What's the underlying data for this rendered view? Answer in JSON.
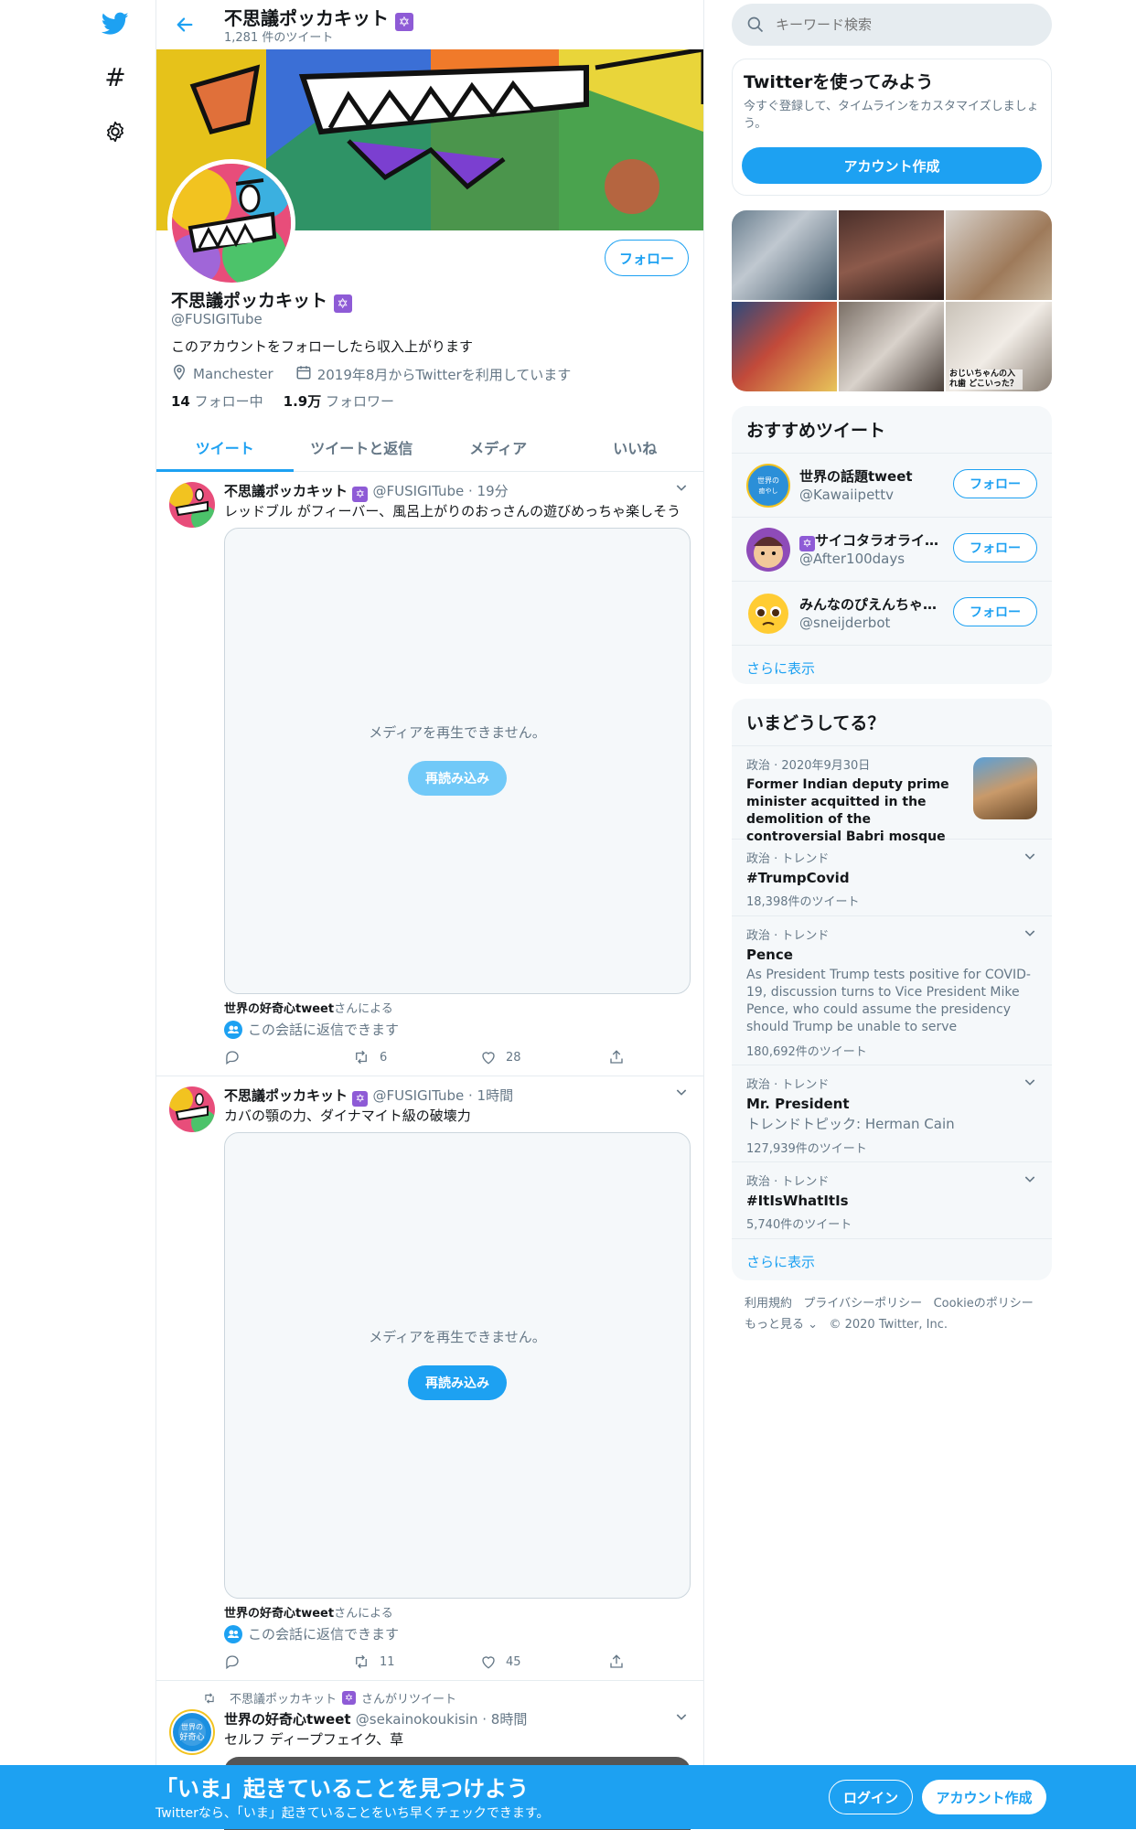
{
  "nav": {
    "brand_color": "#1da1f2"
  },
  "header": {
    "title": "不思議ポッカキット",
    "tweet_count": "1,281 件のツイート"
  },
  "profile": {
    "name": "不思議ポッカキット",
    "handle": "@FUSIGITube",
    "follow_label": "フォロー",
    "bio": "このアカウントをフォローしたら収入上がります",
    "location": "Manchester",
    "joined": "2019年8月からTwitterを利用しています",
    "following_count": "14",
    "following_label": "フォロー中",
    "followers_count": "1.9万",
    "followers_label": "フォロワー"
  },
  "tabs": [
    {
      "label": "ツイート"
    },
    {
      "label": "ツイートと返信"
    },
    {
      "label": "メディア"
    },
    {
      "label": "いいね"
    }
  ],
  "tweets": [
    {
      "name": "不思議ポッカキット",
      "meta": "@FUSIGITube · 19分",
      "text": "レッドブル がフィーバー、風呂上がりのおっさんの遊びめっちゃ楽しそう",
      "media_msg": "メディアを再生できません。",
      "reload": "再読み込み",
      "by_name": "世界の好奇心tweet",
      "by_suffix": "さんによる",
      "convo": "この会話に返信できます",
      "retweets": "6",
      "likes": "28"
    },
    {
      "name": "不思議ポッカキット",
      "meta": "@FUSIGITube · 1時間",
      "text": "カバの顎の力、ダイナマイト級の破壊力",
      "media_msg": "メディアを再生できません。",
      "reload": "再読み込み",
      "by_name": "世界の好奇心tweet",
      "by_suffix": "さんによる",
      "convo": "この会話に返信できます",
      "retweets": "11",
      "likes": "45"
    },
    {
      "retweeted_by": "不思議ポッカキット",
      "retweeted_suffix": "さんがリツイート",
      "name": "世界の好奇心tweet",
      "meta": "@sekainokoukisin · 8時間",
      "text": "セルフ ディープフェイク、草"
    }
  ],
  "search": {
    "placeholder": "キーワード検索"
  },
  "signup_card": {
    "title": "Twitterを使ってみよう",
    "desc": "今すぐ登録して、タイムラインをカスタマイズしましょう。",
    "button": "アカウント作成"
  },
  "photo_caption": "おじいちゃんの入れ歯 どこいった？",
  "recommended": {
    "title": "おすすめツイート",
    "users": [
      {
        "name": "世界の話題tweet",
        "handle": "@Kawaiipettv",
        "follow": "フォロー"
      },
      {
        "name": "サイコタラオライ…",
        "handle": "@After100days",
        "follow": "フォロー"
      },
      {
        "name": "みんなのぴえんちゃ…",
        "handle": "@sneijderbot",
        "follow": "フォロー"
      }
    ],
    "more": "さらに表示"
  },
  "trends": {
    "title": "いまどうしてる？",
    "items": [
      {
        "category": "政治 · 2020年9月30日",
        "title": "Former Indian deputy prime minister acquitted in the demolition of the controversial Babri mosque"
      },
      {
        "category": "政治 · トレンド",
        "title": "#TrumpCovid",
        "count": "18,398件のツイート"
      },
      {
        "category": "政治 · トレンド",
        "title": "Pence",
        "desc": "As President Trump tests positive for COVID-19, discussion turns to Vice President Mike Pence, who could assume the presidency should Trump be unable to serve",
        "count": "180,692件のツイート"
      },
      {
        "category": "政治 · トレンド",
        "title": "Mr. President",
        "desc": "トレンドトピック: Herman Cain",
        "count": "127,939件のツイート"
      },
      {
        "category": "政治 · トレンド",
        "title": "#ItIsWhatItIs",
        "count": "5,740件のツイート"
      }
    ],
    "more": "さらに表示"
  },
  "footer": {
    "terms": "利用規約",
    "privacy": "プライバシーポリシー",
    "cookie": "Cookieのポリシー",
    "more": "もっと見る",
    "copyright": "© 2020 Twitter, Inc."
  },
  "bottom_bar": {
    "headline": "「いま」起きていることを見つけよう",
    "sub": "Twitterなら、「いま」起きていることをいち早くチェックできます。",
    "login": "ログイン",
    "signup": "アカウント作成"
  }
}
